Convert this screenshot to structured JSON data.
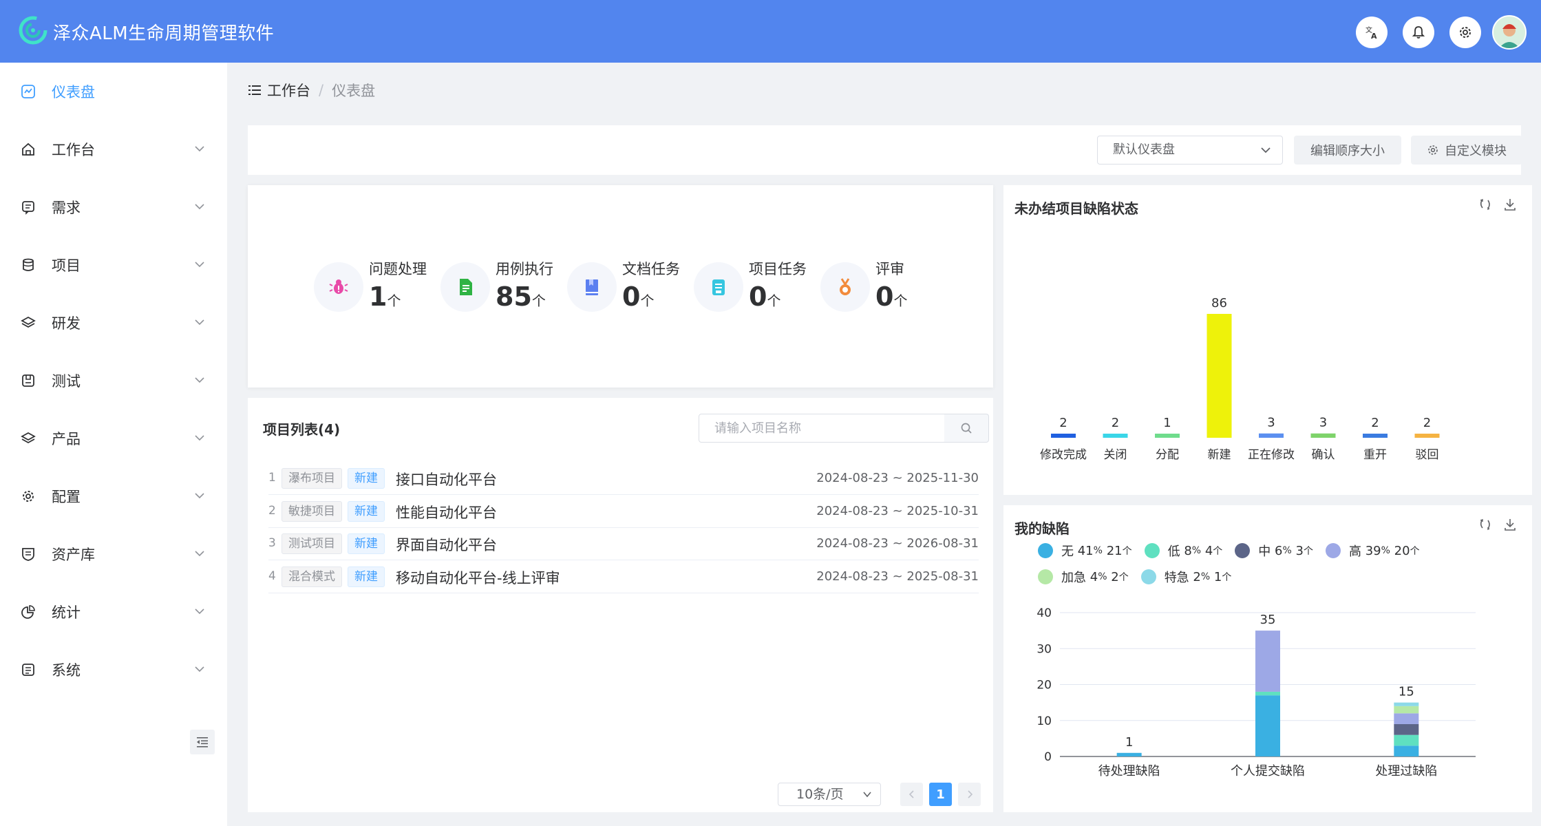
{
  "header": {
    "title": "泽众ALM生命周期管理软件"
  },
  "sidebar": {
    "items": [
      {
        "label": "仪表盘",
        "icon": "dashboard-icon",
        "active": true
      },
      {
        "label": "工作台",
        "icon": "home-icon"
      },
      {
        "label": "需求",
        "icon": "requirement-icon"
      },
      {
        "label": "项目",
        "icon": "project-icon"
      },
      {
        "label": "研发",
        "icon": "layers-icon"
      },
      {
        "label": "测试",
        "icon": "test-icon"
      },
      {
        "label": "产品",
        "icon": "product-icon"
      },
      {
        "label": "配置",
        "icon": "gear-icon"
      },
      {
        "label": "资产库",
        "icon": "asset-icon"
      },
      {
        "label": "统计",
        "icon": "pie-icon"
      },
      {
        "label": "系统",
        "icon": "system-icon"
      }
    ]
  },
  "breadcrumb": {
    "root": "工作台",
    "sep": "/",
    "current": "仪表盘"
  },
  "toolbar": {
    "dashboard_select": "默认仪表盘",
    "edit_order_label": "编辑顺序大小",
    "custom_module_label": "自定义模块"
  },
  "stats": [
    {
      "label": "问题处理",
      "value": "1",
      "unit": "个",
      "icon": "bug-icon",
      "color": "#e84aa8"
    },
    {
      "label": "用例执行",
      "value": "85",
      "unit": "个",
      "icon": "document-icon",
      "color": "#2fb344"
    },
    {
      "label": "文档任务",
      "value": "0",
      "unit": "个",
      "icon": "book-icon",
      "color": "#5b7ff0"
    },
    {
      "label": "项目任务",
      "value": "0",
      "unit": "个",
      "icon": "task-icon",
      "color": "#36c6e0"
    },
    {
      "label": "评审",
      "value": "0",
      "unit": "个",
      "icon": "medal-icon",
      "color": "#f28b3c"
    }
  ],
  "project_list": {
    "title": "项目列表(4)",
    "search_placeholder": "请输入项目名称",
    "rows": [
      {
        "index": "1",
        "type": "瀑布项目",
        "status": "新建",
        "name": "接口自动化平台",
        "dates": "2024-08-23 ~ 2025-11-30"
      },
      {
        "index": "2",
        "type": "敏捷项目",
        "status": "新建",
        "name": "性能自动化平台",
        "dates": "2024-08-23 ~ 2025-10-31"
      },
      {
        "index": "3",
        "type": "测试项目",
        "status": "新建",
        "name": "界面自动化平台",
        "dates": "2024-08-23 ~ 2026-08-31"
      },
      {
        "index": "4",
        "type": "混合模式",
        "status": "新建",
        "name": "移动自动化平台-线上评审",
        "dates": "2024-08-23 ~ 2025-08-31"
      }
    ],
    "page_size": "10条/页",
    "current_page": "1"
  },
  "chart_data": [
    {
      "type": "bar",
      "title": "未办结项目缺陷状态",
      "categories": [
        "修改完成",
        "关闭",
        "分配",
        "新建",
        "正在修改",
        "确认",
        "重开",
        "驳回"
      ],
      "values": [
        2,
        2,
        1,
        86,
        3,
        3,
        2,
        2
      ],
      "colors": [
        "#2060e0",
        "#3ad6e8",
        "#6fdc8c",
        "#eef20a",
        "#5b8ff0",
        "#7ed36a",
        "#3a7be0",
        "#f5b342"
      ],
      "grid": false
    },
    {
      "type": "bar",
      "stacked": true,
      "title": "我的缺陷",
      "categories": [
        "待处理缺陷",
        "个人提交缺陷",
        "处理过缺陷"
      ],
      "ylim": [
        0,
        40
      ],
      "yticks": [
        0,
        10,
        20,
        30,
        40
      ],
      "totals": [
        1,
        35,
        15
      ],
      "legend_position": "top",
      "legend": [
        {
          "name": "无",
          "pct": "41",
          "count": "21",
          "pct_unit": "%",
          "count_unit": "个",
          "color": "#3ab0e2"
        },
        {
          "name": "低",
          "pct": "8",
          "count": "4",
          "pct_unit": "%",
          "count_unit": "个",
          "color": "#5fe0c0"
        },
        {
          "name": "中",
          "pct": "6",
          "count": "3",
          "pct_unit": "%",
          "count_unit": "个",
          "color": "#5c6588"
        },
        {
          "name": "高",
          "pct": "39",
          "count": "20",
          "pct_unit": "%",
          "count_unit": "个",
          "color": "#9da8e6"
        },
        {
          "name": "加急",
          "pct": "4",
          "count": "2",
          "pct_unit": "%",
          "count_unit": "个",
          "color": "#b5e8a6"
        },
        {
          "name": "特急",
          "pct": "2",
          "count": "1",
          "pct_unit": "%",
          "count_unit": "个",
          "color": "#8cd9e8"
        }
      ],
      "series": [
        {
          "name": "无",
          "values": [
            1,
            17,
            3
          ],
          "color": "#3ab0e2"
        },
        {
          "name": "低",
          "values": [
            0,
            1,
            3
          ],
          "color": "#5fe0c0"
        },
        {
          "name": "中",
          "values": [
            0,
            0,
            3
          ],
          "color": "#5c6588"
        },
        {
          "name": "高",
          "values": [
            0,
            17,
            3
          ],
          "color": "#9da8e6"
        },
        {
          "name": "加急",
          "values": [
            0,
            0,
            2
          ],
          "color": "#b5e8a6"
        },
        {
          "name": "特急",
          "values": [
            0,
            0,
            1
          ],
          "color": "#8cd9e8"
        }
      ],
      "grid": true
    }
  ]
}
